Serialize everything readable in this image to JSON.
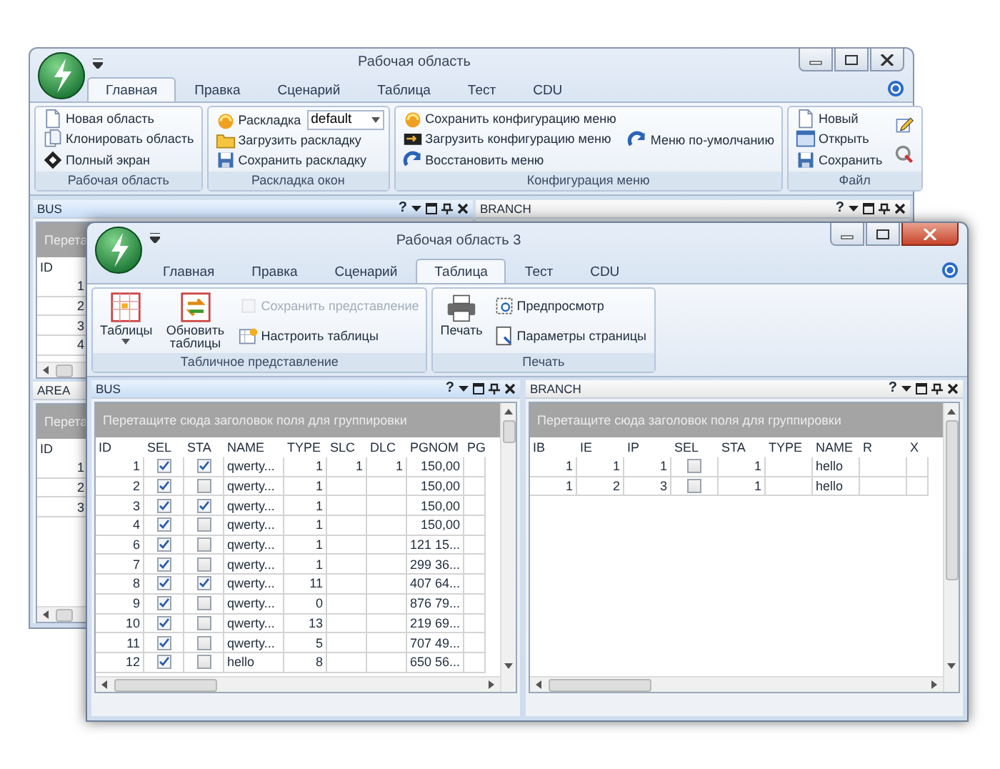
{
  "back_window": {
    "title": "Рабочая область",
    "tabs": [
      {
        "label": "Главная",
        "selected": true
      },
      {
        "label": "Правка",
        "selected": false
      },
      {
        "label": "Сценарий",
        "selected": false
      },
      {
        "label": "Таблица",
        "selected": false
      },
      {
        "label": "Тест",
        "selected": false
      },
      {
        "label": "CDU",
        "selected": false
      }
    ],
    "ribbon": [
      {
        "label": "Рабочая область",
        "columns": [
          {
            "kind": "stack",
            "items": [
              {
                "kind": "button",
                "label": "Новая область"
              },
              {
                "kind": "button",
                "label": "Клонировать область"
              },
              {
                "kind": "button",
                "label": "Полный экран"
              }
            ]
          }
        ]
      },
      {
        "label": "Раскладка окон",
        "columns": [
          {
            "kind": "stack",
            "items": [
              {
                "kind": "combo",
                "label": "Раскладка",
                "value": "default"
              },
              {
                "kind": "button",
                "label": "Загрузить раскладку"
              },
              {
                "kind": "button",
                "label": "Сохранить раскладку"
              }
            ]
          }
        ]
      },
      {
        "label": "Конфигурация меню",
        "columns": [
          {
            "kind": "stack",
            "items": [
              {
                "kind": "button",
                "label": "Сохранить конфигурацию меню"
              },
              {
                "kind": "button",
                "label": "Загрузить конфигурацию меню"
              },
              {
                "kind": "button",
                "label": "Восстановить меню"
              }
            ]
          },
          {
            "kind": "stack",
            "items": [
              {
                "kind": "button",
                "label": "Меню по-умолчанию"
              }
            ]
          }
        ]
      },
      {
        "label": "Файл",
        "columns": [
          {
            "kind": "stack",
            "items": [
              {
                "kind": "button",
                "label": "Новый"
              },
              {
                "kind": "button",
                "label": "Открыть"
              },
              {
                "kind": "button",
                "label": "Сохранить"
              }
            ]
          },
          {
            "kind": "stack",
            "items": [
              {
                "kind": "icon"
              },
              {
                "kind": "icon"
              }
            ]
          }
        ]
      }
    ],
    "panels": [
      {
        "title": "BUS",
        "selected": true,
        "help": "?",
        "group_hint": "Перета",
        "columns": [
          {
            "label": "ID",
            "kind": "num"
          }
        ],
        "rows": [
          {
            "cells": [
              "1"
            ]
          },
          {
            "cells": [
              "2"
            ]
          },
          {
            "cells": [
              "3"
            ]
          },
          {
            "cells": [
              "4"
            ]
          }
        ]
      },
      {
        "title": "BRANCH",
        "selected": false,
        "help": "?"
      },
      {
        "title": "AREA",
        "selected": false,
        "group_hint": "Перета",
        "columns": [
          {
            "label": "ID",
            "kind": "num"
          }
        ],
        "rows": [
          {
            "cells": [
              "1"
            ]
          },
          {
            "cells": [
              "2"
            ]
          },
          {
            "cells": [
              "3"
            ]
          }
        ]
      }
    ]
  },
  "front_window": {
    "title": "Рабочая область 3",
    "tabs": [
      {
        "label": "Главная",
        "selected": false
      },
      {
        "label": "Правка",
        "selected": false
      },
      {
        "label": "Сценарий",
        "selected": false
      },
      {
        "label": "Таблица",
        "selected": true
      },
      {
        "label": "Тест",
        "selected": false
      },
      {
        "label": "CDU",
        "selected": false
      }
    ],
    "ribbon": [
      {
        "label": "Табличное представление",
        "columns": [
          {
            "kind": "large",
            "label": "Таблицы",
            "dropdown": true
          },
          {
            "kind": "large",
            "label": "Обновить таблицы",
            "dropdown": false
          },
          {
            "kind": "stack",
            "items": [
              {
                "kind": "button",
                "label": "Сохранить представление",
                "disabled": true
              },
              {
                "kind": "button",
                "label": "Настроить таблицы",
                "disabled": false
              }
            ]
          }
        ]
      },
      {
        "label": "Печать",
        "columns": [
          {
            "kind": "large",
            "label": "Печать",
            "dropdown": false
          },
          {
            "kind": "stack",
            "items": [
              {
                "kind": "button",
                "label": "Предпросмотр",
                "disabled": false
              },
              {
                "kind": "button",
                "label": "Параметры страницы",
                "disabled": false
              }
            ]
          }
        ]
      }
    ],
    "panels": [
      {
        "title": "BUS",
        "selected": true,
        "help": "?",
        "group_hint": "Перетащите сюда заголовок поля для группировки",
        "columns": [
          {
            "label": "ID",
            "kind": "num"
          },
          {
            "label": "SEL",
            "kind": "check"
          },
          {
            "label": "STA",
            "kind": "check"
          },
          {
            "label": "NAME",
            "kind": "text"
          },
          {
            "label": "TYPE",
            "kind": "num"
          },
          {
            "label": "SLC",
            "kind": "num"
          },
          {
            "label": "DLC",
            "kind": "num"
          },
          {
            "label": "PGNOM",
            "kind": "num"
          },
          {
            "label": "PG",
            "kind": "text"
          }
        ],
        "rows": [
          {
            "cells": [
              "1",
              {
                "checked": true
              },
              {
                "checked": true
              },
              "qwerty...",
              "1",
              "1",
              "1",
              "150,00"
            ]
          },
          {
            "cells": [
              "2",
              {
                "checked": true
              },
              {
                "checked": false
              },
              "qwerty...",
              "1",
              null,
              null,
              "150,00"
            ]
          },
          {
            "cells": [
              "3",
              {
                "checked": true
              },
              {
                "checked": true
              },
              "qwerty...",
              "1",
              null,
              null,
              "150,00"
            ]
          },
          {
            "cells": [
              "4",
              {
                "checked": true
              },
              {
                "checked": false
              },
              "qwerty...",
              "1",
              null,
              null,
              "150,00"
            ]
          },
          {
            "cells": [
              "6",
              {
                "checked": true
              },
              {
                "checked": false
              },
              "qwerty...",
              "1",
              null,
              null,
              "121 15..."
            ]
          },
          {
            "cells": [
              "7",
              {
                "checked": true
              },
              {
                "checked": false
              },
              "qwerty...",
              "1",
              null,
              null,
              "299 36..."
            ]
          },
          {
            "cells": [
              "8",
              {
                "checked": true
              },
              {
                "checked": true
              },
              "qwerty...",
              "11",
              null,
              null,
              "407 64..."
            ]
          },
          {
            "cells": [
              "9",
              {
                "checked": true
              },
              {
                "checked": false
              },
              "qwerty...",
              "0",
              null,
              null,
              "876 79..."
            ]
          },
          {
            "cells": [
              "10",
              {
                "checked": true
              },
              {
                "checked": false
              },
              "qwerty...",
              "13",
              null,
              null,
              "219 69..."
            ]
          },
          {
            "cells": [
              "11",
              {
                "checked": true
              },
              {
                "checked": false
              },
              "qwerty...",
              "5",
              null,
              null,
              "707 49..."
            ]
          },
          {
            "cells": [
              "12",
              {
                "checked": true
              },
              {
                "checked": false
              },
              "hello",
              "8",
              null,
              null,
              "650 56..."
            ]
          }
        ]
      },
      {
        "title": "BRANCH",
        "selected": false,
        "help": "?",
        "group_hint": "Перетащите сюда заголовок поля для группировки",
        "columns": [
          {
            "label": "IB",
            "kind": "num"
          },
          {
            "label": "IE",
            "kind": "num"
          },
          {
            "label": "IP",
            "kind": "num"
          },
          {
            "label": "SEL",
            "kind": "check"
          },
          {
            "label": "STA",
            "kind": "num"
          },
          {
            "label": "TYPE",
            "kind": "text"
          },
          {
            "label": "NAME",
            "kind": "text"
          },
          {
            "label": "R",
            "kind": "num"
          },
          {
            "label": "X",
            "kind": "num"
          }
        ],
        "rows": [
          {
            "cells": [
              "1",
              "1",
              "1",
              {
                "checked": false
              },
              "1",
              null,
              "hello",
              null
            ]
          },
          {
            "cells": [
              "1",
              "2",
              "3",
              {
                "checked": false
              },
              "1",
              null,
              "hello",
              null
            ]
          }
        ]
      }
    ]
  }
}
